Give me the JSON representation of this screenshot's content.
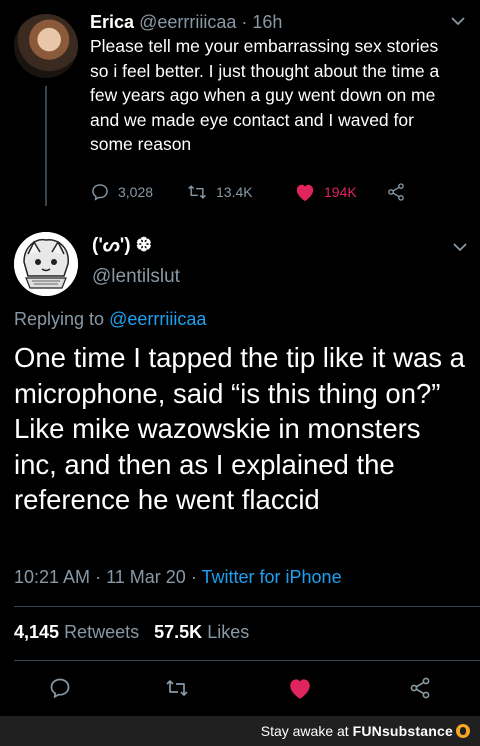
{
  "tweet": {
    "author_name": "Erica",
    "author_handle": "@eerrriiicaa",
    "separator": "·",
    "age": "16h",
    "text": "Please tell me your embarrassing sex stories so i feel better. I just thought about the time a few years ago when a guy went down on me and we made eye contact and I waved for some reason",
    "replies": "3,028",
    "retweets": "13.4K",
    "likes": "194K",
    "liked": true
  },
  "reply": {
    "author_name": "('ᔕ') ❆",
    "author_handle": "@lentilslut",
    "replying_prefix": "Replying to ",
    "replying_to": "@eerrriiicaa",
    "text": "One time I tapped the tip like it was a microphone, said “is this thing on?” Like mike wazowskie in monsters inc, and then as I explained the reference he went flaccid",
    "time": "10:21 AM",
    "date": "11 Mar 20",
    "separator": "·",
    "source": "Twitter for iPhone",
    "retweets_count": "4,145",
    "retweets_label": "Retweets",
    "likes_count": "57.5K",
    "likes_label": "Likes",
    "liked": true
  },
  "footer": {
    "prefix": "Stay awake at ",
    "brand_fun": "FUN",
    "brand_substance": "substance"
  },
  "colors": {
    "background": "#000000",
    "muted": "#8899a6",
    "link": "#1da1f2",
    "like": "#e0245e",
    "divider": "#38444d"
  },
  "icons": [
    "reply-icon",
    "retweet-icon",
    "heart-icon",
    "share-icon",
    "chevron-down-icon",
    "brand-logo-icon"
  ]
}
